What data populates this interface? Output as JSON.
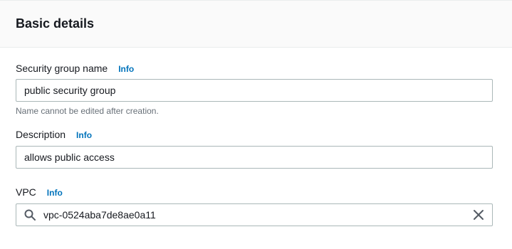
{
  "section": {
    "title": "Basic details"
  },
  "fields": {
    "name": {
      "label": "Security group name",
      "info": "Info",
      "value": "public security group",
      "constraint": "Name cannot be edited after creation."
    },
    "description": {
      "label": "Description",
      "info": "Info",
      "value": "allows public access"
    },
    "vpc": {
      "label": "VPC",
      "info": "Info",
      "value": "vpc-0524aba7de8ae0a11"
    }
  },
  "icons": {
    "search": "search-icon",
    "clear": "close-icon"
  },
  "colors": {
    "link": "#0073bb",
    "header_bg": "#fafafa",
    "border": "#aab7b8"
  }
}
